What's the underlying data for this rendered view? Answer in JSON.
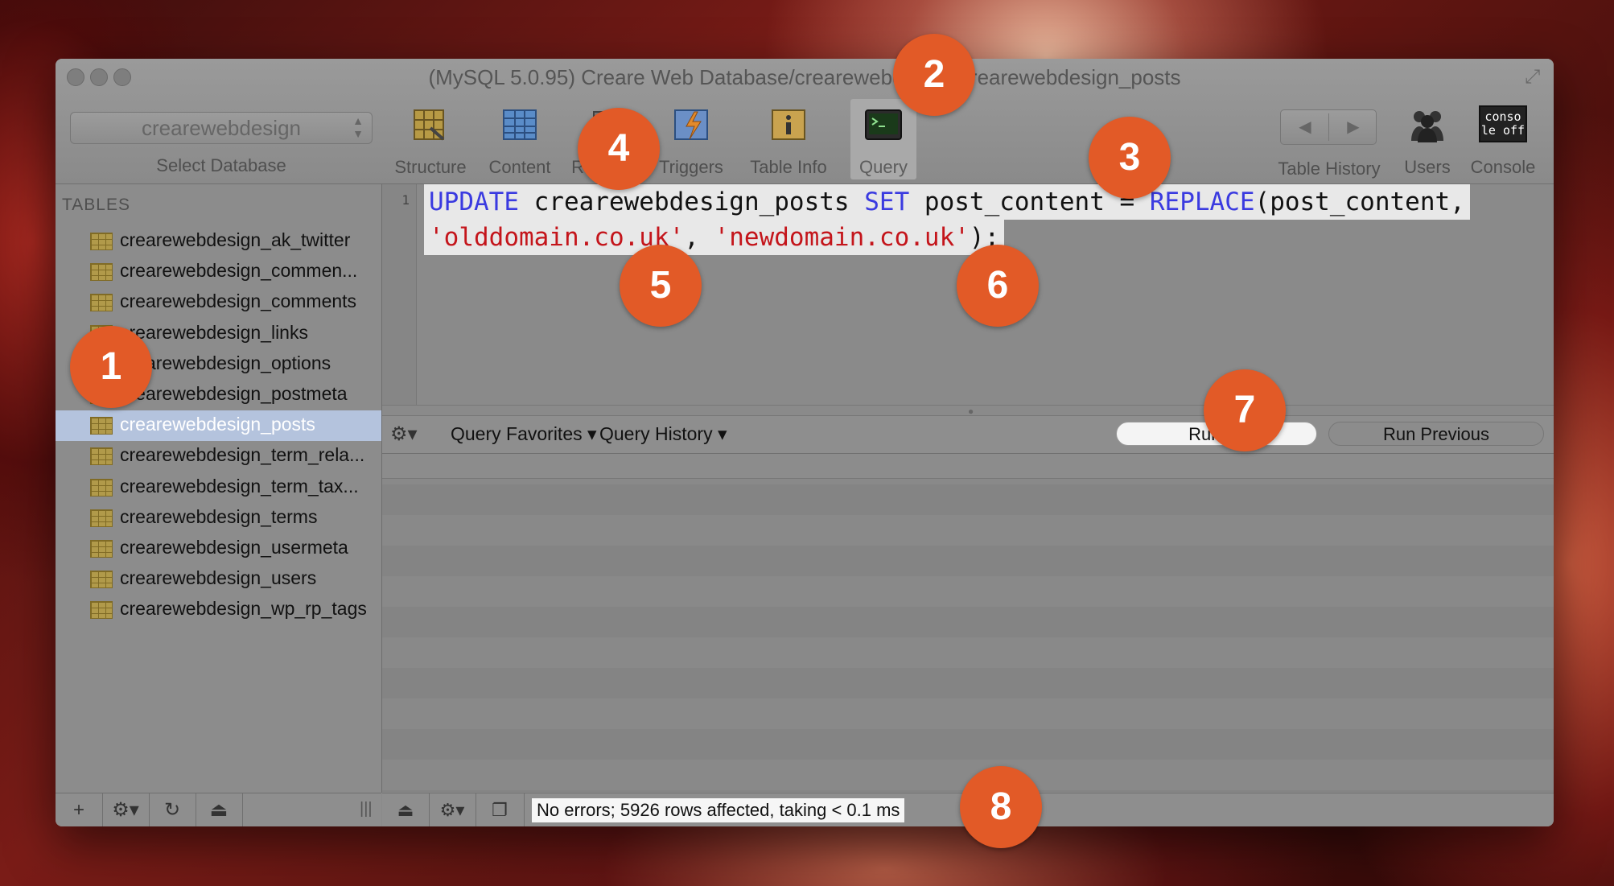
{
  "window": {
    "title": "(MySQL 5.0.95) Creare Web Database/crearewebdesign/crearewebdesign_posts"
  },
  "database_selector": {
    "value": "crearewebdesign",
    "label": "Select Database"
  },
  "toolbar": {
    "items": [
      {
        "label": "Structure",
        "icon": "structure-icon"
      },
      {
        "label": "Content",
        "icon": "content-icon"
      },
      {
        "label": "Relations",
        "icon": "relations-icon"
      },
      {
        "label": "Triggers",
        "icon": "triggers-icon"
      },
      {
        "label": "Table Info",
        "icon": "table-info-icon"
      },
      {
        "label": "Query",
        "icon": "terminal-icon",
        "active": true
      }
    ],
    "right_items": [
      {
        "label": "Table History",
        "icon": "history-nav-icon"
      },
      {
        "label": "Users",
        "icon": "users-icon"
      },
      {
        "label": "Console",
        "icon": "console-icon",
        "icon_text": "conso le off"
      }
    ]
  },
  "sidebar": {
    "header": "TABLES",
    "tables": [
      "crearewebdesign_ak_twitter",
      "crearewebdesign_commen...",
      "crearewebdesign_comments",
      "crearewebdesign_links",
      "crearewebdesign_options",
      "crearewebdesign_postmeta",
      "crearewebdesign_posts",
      "crearewebdesign_term_rela...",
      "crearewebdesign_term_tax...",
      "crearewebdesign_terms",
      "crearewebdesign_usermeta",
      "crearewebdesign_users",
      "crearewebdesign_wp_rp_tags"
    ],
    "selected": "crearewebdesign_posts"
  },
  "editor": {
    "line_number": "1",
    "line1": {
      "kw1": "UPDATE",
      "t1": " crearewebdesign_posts ",
      "kw2": "SET",
      "t2": " post_content = ",
      "kw3": "REPLACE",
      "t3": "(post_content,"
    },
    "line2": {
      "s1": "'olddomain.co.uk'",
      "t1": ", ",
      "s2": "'newdomain.co.uk'",
      "t2": ");"
    }
  },
  "query_bar": {
    "favorites": "Query Favorites",
    "history": "Query History",
    "run_all": "Run All",
    "run_previous": "Run Previous"
  },
  "status": {
    "message": "No errors; 5926 rows affected, taking < 0.1 ms"
  },
  "annotations": [
    "1",
    "2",
    "3",
    "4",
    "5",
    "6",
    "7",
    "8"
  ],
  "colors": {
    "badge": "#e25a27",
    "keyword": "#3a3ae0",
    "string": "#c4151b",
    "selection": "#b4c3dd"
  }
}
